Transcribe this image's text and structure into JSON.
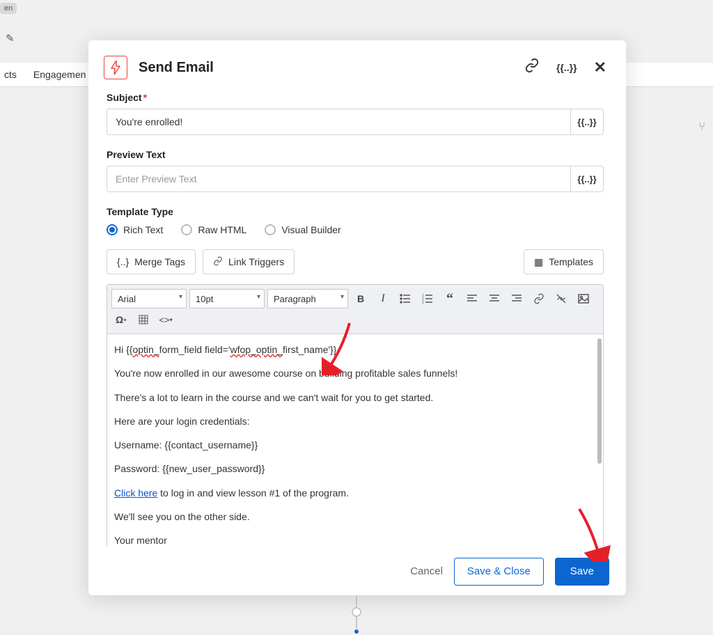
{
  "bg": {
    "tag": "en",
    "nav1": "cts",
    "nav2": "Engagemen"
  },
  "header": {
    "title": "Send Email",
    "merge_symbol": "{{..}}"
  },
  "subject": {
    "label": "Subject",
    "value": "You're enrolled!",
    "suffix": "{{..}}"
  },
  "preview": {
    "label": "Preview Text",
    "placeholder": "Enter Preview Text",
    "suffix": "{{..}}"
  },
  "template_type": {
    "label": "Template Type",
    "options": [
      "Rich Text",
      "Raw HTML",
      "Visual Builder"
    ],
    "selected": 0
  },
  "buttons": {
    "merge_tags": "Merge Tags",
    "link_triggers": "Link Triggers",
    "templates": "Templates"
  },
  "toolbar": {
    "font": "Arial",
    "size": "10pt",
    "format": "Paragraph"
  },
  "editor": {
    "line1_pre": "Hi {{",
    "line1_wavy1": "optin_",
    "line1_mid": "form_field field='",
    "line1_wavy2": "wfop_optin_",
    "line1_end": "first_name'}},",
    "line2": "You're now enrolled in our awesome course on building profitable sales funnels!",
    "line3": "There's a lot to learn in the course and we can't wait for you to get started.",
    "line4": "Here are your login credentials:",
    "line5": "Username: {{contact_username}}",
    "line6": "Password: {{new_user_password}}",
    "line7_link": "Click here",
    "line7_rest": " to log in and view lesson #1 of the program.",
    "line8": "We'll see you on the other side.",
    "line9": "Your mentor"
  },
  "footer": {
    "cancel": "Cancel",
    "save_close": "Save & Close",
    "save": "Save"
  }
}
